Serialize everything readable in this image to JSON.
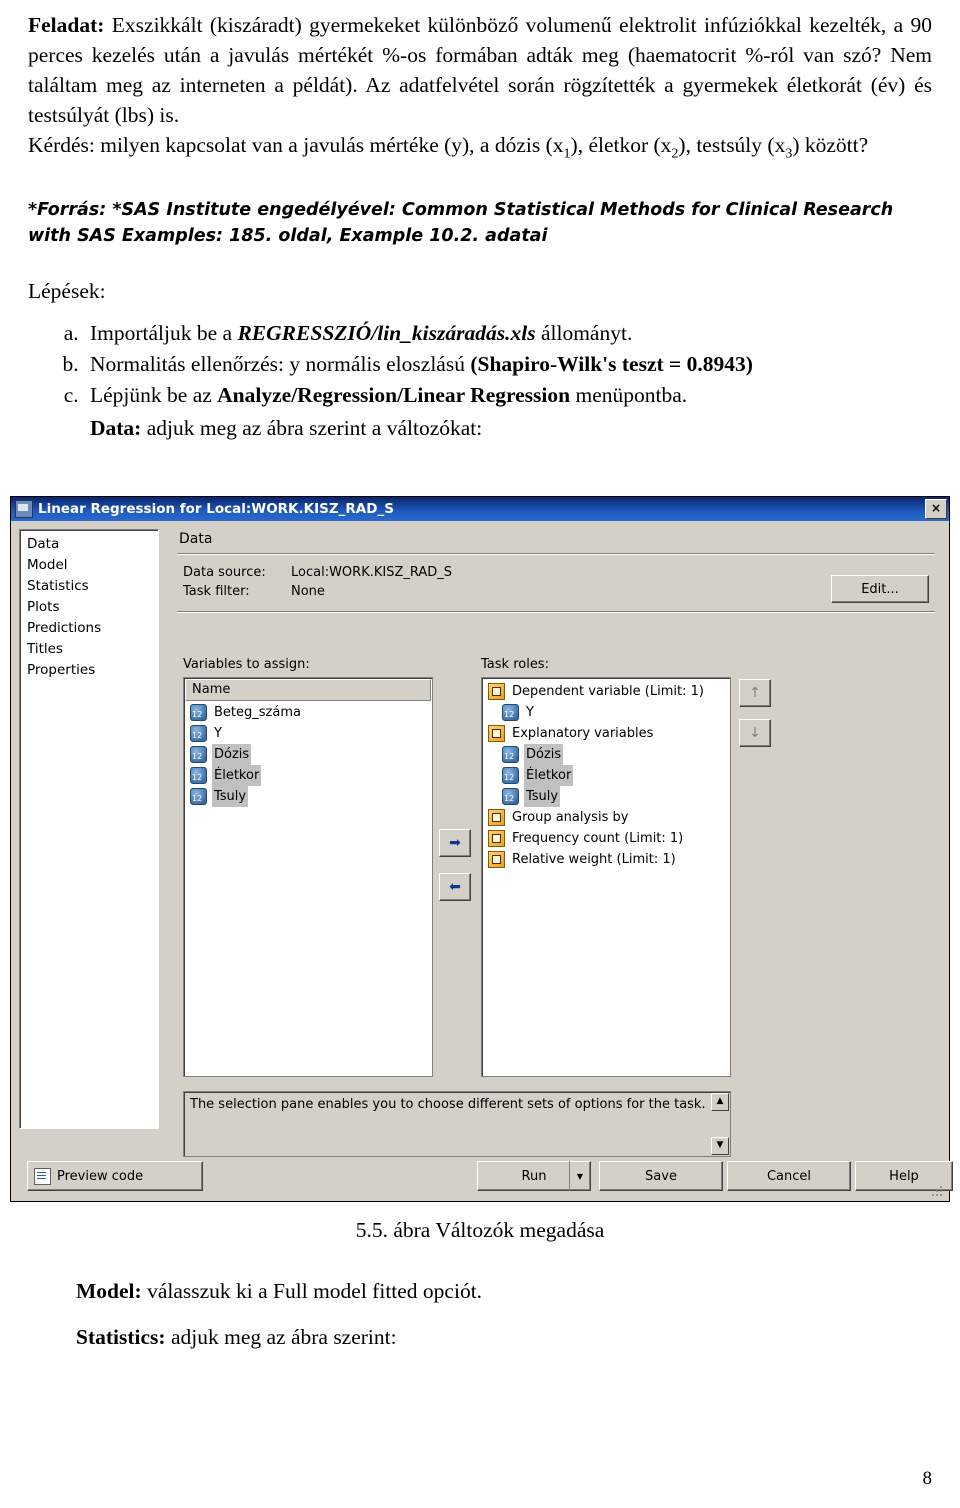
{
  "task": {
    "label": "Feladat:",
    "body_1": " Exszikkált (kiszáradt) gyermekeket különböző volumenű elektrolit infúziókkal kezelték, a 90 perces kezelés után a javulás mértékét %-os formában adták meg (haematocrit %-ról van szó? Nem találtam meg az interneten a példát). Az adatfelvétel során rögzítették a gyermekek életkorát (év) és testsúlyát (lbs) is.",
    "question_prefix": "Kérdés: milyen kapcsolat van a javulás mértéke (y), a dózis (x",
    "sub1": "1",
    "question_mid1": "), életkor (x",
    "sub2": "2",
    "question_mid2": "), testsúly (x",
    "sub3": "3",
    "question_suffix": ") között?"
  },
  "source": {
    "text": "*Forrás: *SAS Institute engedélyével: Common Statistical Methods for Clinical Research with SAS Examples: 185. oldal, Example 10.2. adatai"
  },
  "steps": {
    "title": "Lépések:",
    "a_pre": "Importáljuk be a ",
    "a_bold": "REGRESSZIÓ/lin_kiszáradás.xls",
    "a_post": " állományt.",
    "b_pre": "Normalitás ellenőrzés: y normális eloszlású ",
    "b_bold": "(Shapiro-Wilk's teszt = 0.8943)",
    "c_pre": "Lépjünk be az ",
    "c_bold": "Analyze/Regression/Linear Regression",
    "c_post": " menüpontba.",
    "data_bold": "Data:",
    "data_rest": " adjuk meg az ábra szerint a változókat:"
  },
  "dialog": {
    "title": "Linear Regression for Local:WORK.KISZ_RAD_S",
    "close_label": "×",
    "nav_items": [
      "Data",
      "Model",
      "Statistics",
      "Plots",
      "Predictions",
      "Titles",
      "Properties"
    ],
    "nav_selected_index": 0,
    "section_label": "Data",
    "data_source_label": "Data source:",
    "data_source_value": "Local:WORK.KISZ_RAD_S",
    "task_filter_label": "Task filter:",
    "task_filter_value": "None",
    "edit_button": "Edit...",
    "variables_label": "Variables to assign:",
    "roles_label": "Task roles:",
    "variables_header": "Name",
    "variables": [
      "Beteg_száma",
      "Y",
      "Dózis",
      "Életkor",
      "Tsuly"
    ],
    "variables_selected": [
      "Dózis",
      "Életkor",
      "Tsuly"
    ],
    "roles": [
      {
        "label": "Dependent variable (Limit: 1)",
        "level": 0,
        "assigned": false
      },
      {
        "label": "Y",
        "level": 1,
        "assigned": true
      },
      {
        "label": "Explanatory variables",
        "level": 0,
        "assigned": false
      },
      {
        "label": "Dózis",
        "level": 1,
        "assigned": true
      },
      {
        "label": "Életkor",
        "level": 1,
        "assigned": true
      },
      {
        "label": "Tsuly",
        "level": 1,
        "assigned": true
      },
      {
        "label": "Group analysis by",
        "level": 0,
        "assigned": false
      },
      {
        "label": "Frequency count (Limit: 1)",
        "level": 0,
        "assigned": false
      },
      {
        "label": "Relative weight (Limit: 1)",
        "level": 0,
        "assigned": false
      }
    ],
    "arrow_right": "➡",
    "arrow_left": "⬅",
    "arrow_up": "↑",
    "arrow_down": "↓",
    "hint_text": "The selection pane enables you to choose different sets of options for the task.",
    "scroll_up": "▲",
    "scroll_down": "▼",
    "buttons": {
      "preview": "Preview code",
      "run": "Run",
      "run_arrow": "▼",
      "save": "Save",
      "cancel": "Cancel",
      "help": "Help"
    }
  },
  "figure_caption": "5.5. ábra Változók megadása",
  "after": {
    "model_bold": "Model:",
    "model_rest": " válasszuk ki a Full model fitted opciót.",
    "stats_bold": "Statistics:",
    "stats_rest": " adjuk meg az ábra szerint:"
  },
  "page_number": "8"
}
